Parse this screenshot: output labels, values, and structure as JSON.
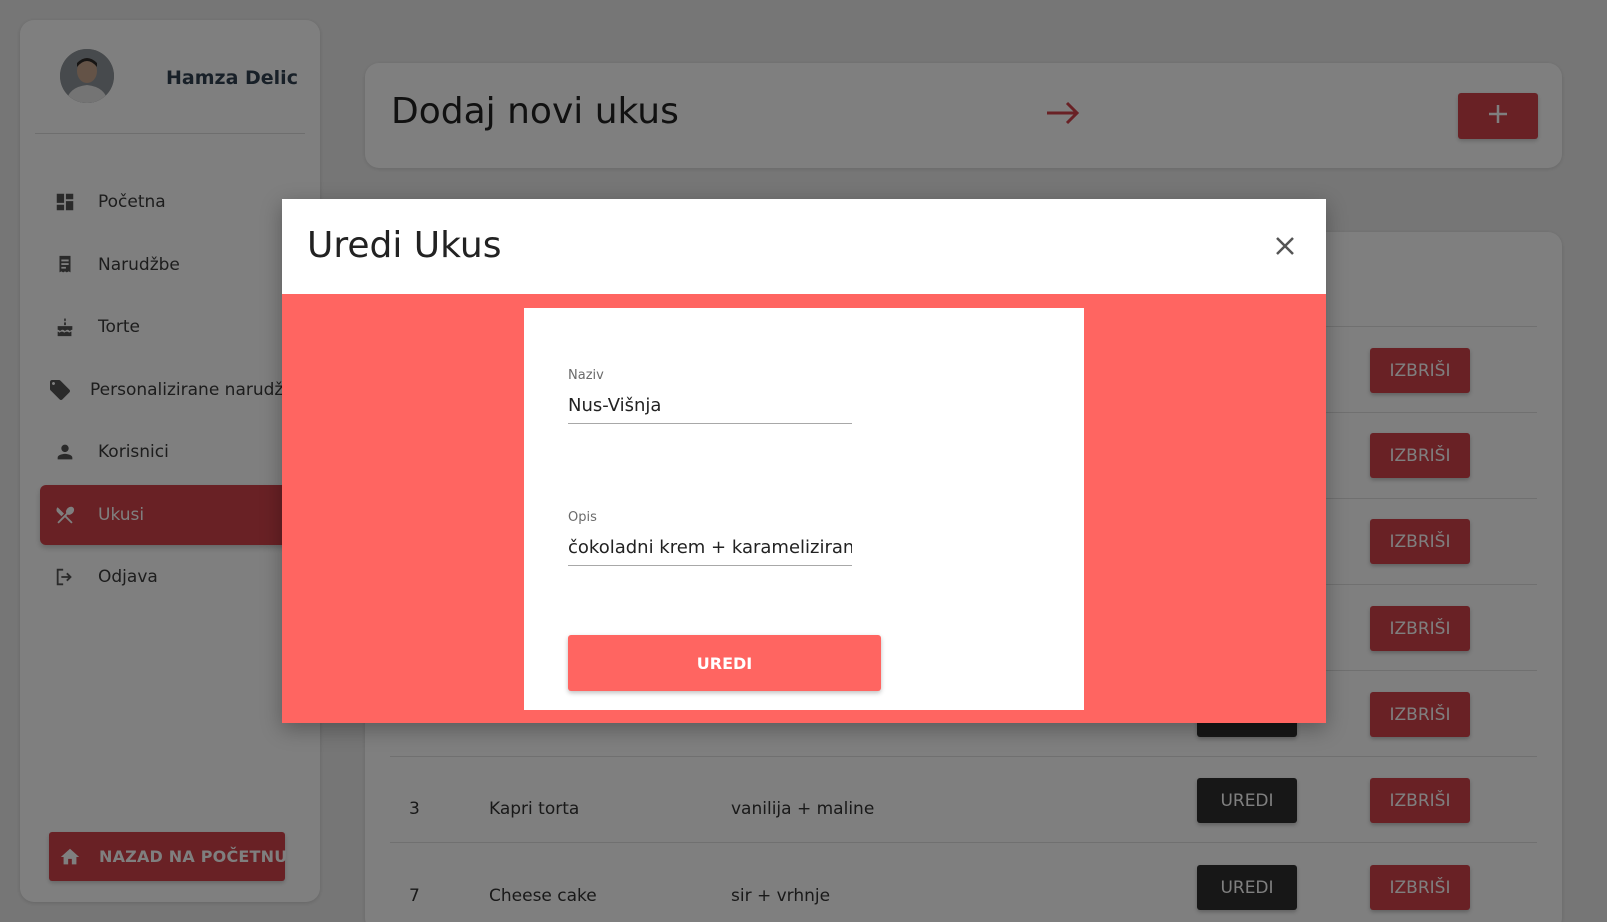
{
  "sidebar": {
    "user_name": "Hamza Delic",
    "items": [
      {
        "label": "Početna",
        "icon": "dashboard-icon"
      },
      {
        "label": "Narudžbe",
        "icon": "receipt-icon"
      },
      {
        "label": "Torte",
        "icon": "cake-icon"
      },
      {
        "label": "Personalizirane narudžbe",
        "icon": "tag-icon"
      },
      {
        "label": "Korisnici",
        "icon": "person-icon"
      },
      {
        "label": "Ukusi",
        "icon": "utensils-icon"
      },
      {
        "label": "Odjava",
        "icon": "logout-icon"
      }
    ],
    "active_item": "Ukusi",
    "home_button": "NAZAD NA POČETNU"
  },
  "header": {
    "title": "Dodaj novi ukus",
    "add_icon": "plus-icon",
    "arrow_icon": "arrow-right-icon"
  },
  "table": {
    "rows": [
      {
        "id": "",
        "name": "",
        "description": "",
        "edit": "",
        "delete": "IZBRIŠI"
      },
      {
        "id": "",
        "name": "",
        "description": "",
        "edit": "",
        "delete": "IZBRIŠI"
      },
      {
        "id": "",
        "name": "",
        "description": "",
        "edit": "",
        "delete": "IZBRIŠI"
      },
      {
        "id": "",
        "name": "",
        "description": "",
        "edit": "",
        "delete": "IZBRIŠI"
      },
      {
        "id": "",
        "name": "",
        "description": "",
        "edit": "",
        "delete": "IZBRIŠI"
      },
      {
        "id": "3",
        "name": "Kapri torta",
        "description": "vanilija + maline",
        "edit": "UREDI",
        "delete": "IZBRIŠI"
      },
      {
        "id": "7",
        "name": "Cheese cake",
        "description": "sir + vrhnje",
        "edit": "UREDI",
        "delete": "IZBRIŠI"
      }
    ]
  },
  "modal": {
    "title": "Uredi Ukus",
    "name_label": "Naziv",
    "name_value": "Nus-Višnja",
    "description_label": "Opis",
    "description_value": "čokoladni krem + karamelizirane višnje",
    "submit_label": "UREDI"
  },
  "colors": {
    "accent": "#d2434a",
    "modal_bg": "#ff6561",
    "dark_button": "#2f2f2f"
  }
}
